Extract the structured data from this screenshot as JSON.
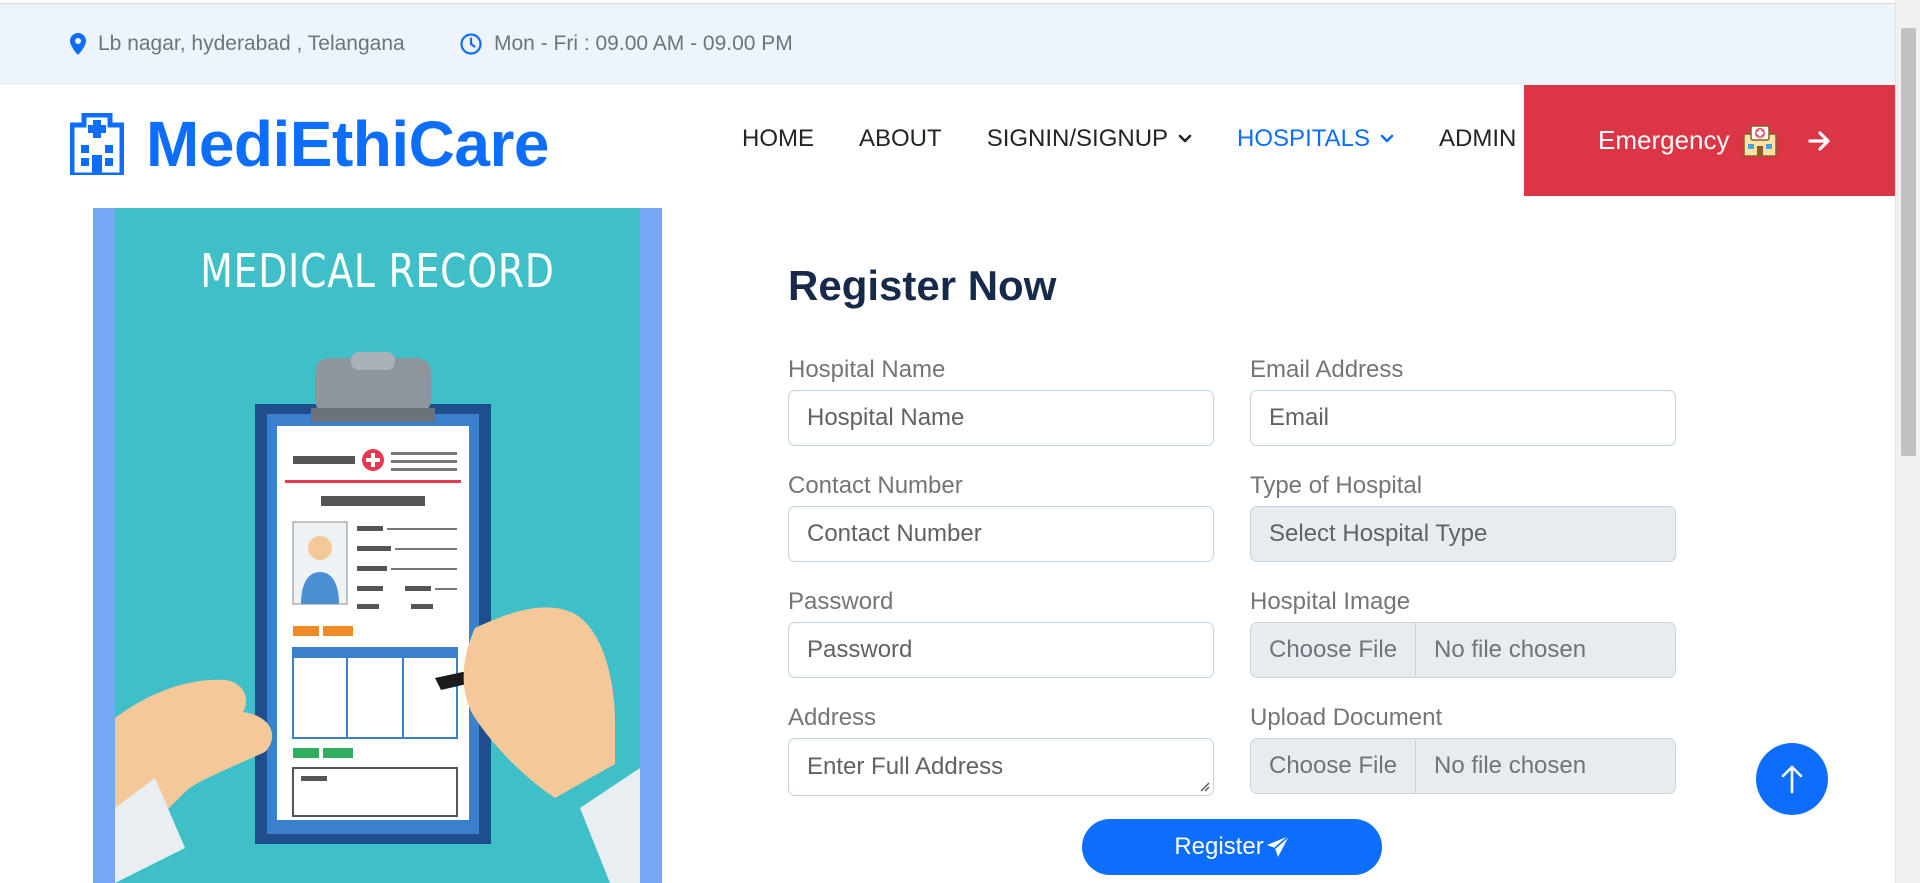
{
  "topbar": {
    "location": "Lb nagar, hyderabad , Telangana",
    "hours": "Mon - Fri : 09.00 AM - 09.00 PM"
  },
  "brand": {
    "name": "MediEthiCare"
  },
  "nav": {
    "home": "HOME",
    "about": "ABOUT",
    "signin": "SIGNIN/SIGNUP",
    "hospitals": "HOSPITALS",
    "admin": "ADMIN",
    "emergency": "Emergency"
  },
  "illustration": {
    "title": "MEDICAL RECORD"
  },
  "form": {
    "title": "Register Now",
    "hospital_name": {
      "label": "Hospital Name",
      "placeholder": "Hospital Name"
    },
    "email": {
      "label": "Email Address",
      "placeholder": "Email"
    },
    "contact": {
      "label": "Contact Number",
      "placeholder": "Contact Number"
    },
    "type": {
      "label": "Type of Hospital",
      "selected": "Select Hospital Type"
    },
    "password": {
      "label": "Password",
      "placeholder": "Password"
    },
    "image": {
      "label": "Hospital Image",
      "choose": "Choose File",
      "status": "No file chosen"
    },
    "address": {
      "label": "Address",
      "placeholder": "Enter Full Address"
    },
    "document": {
      "label": "Upload Document",
      "choose": "Choose File",
      "status": "No file chosen"
    },
    "submit": "Register"
  },
  "colors": {
    "primary": "#0d6efd",
    "danger": "#dc3545",
    "topbar_bg": "#eef4fc",
    "heading": "#172a4a"
  }
}
